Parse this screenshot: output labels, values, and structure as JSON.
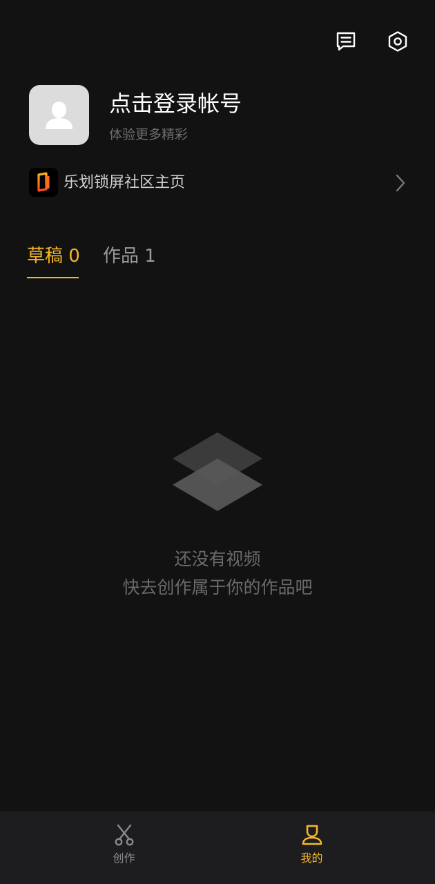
{
  "header": {
    "message_icon": "message-icon",
    "settings_icon": "settings-hexagon-icon"
  },
  "profile": {
    "avatar_icon": "user-silhouette-icon",
    "title": "点击登录帐号",
    "subtitle": "体验更多精彩"
  },
  "community": {
    "logo_icon": "community-logo-icon",
    "label": "乐划锁屏社区主页",
    "chevron_icon": "chevron-right-icon"
  },
  "tabs": [
    {
      "label": "草稿 0",
      "active": true
    },
    {
      "label": "作品 1",
      "active": false
    }
  ],
  "empty_state": {
    "icon": "stacked-layers-icon",
    "title": "还没有视频",
    "subtitle": "快去创作属于你的作品吧"
  },
  "bottom_nav": {
    "items": [
      {
        "label": "创作",
        "icon": "scissors-icon",
        "active": false
      },
      {
        "label": "我的",
        "icon": "profile-icon",
        "active": true
      }
    ]
  },
  "colors": {
    "background": "#121212",
    "accent": "#f5b728",
    "inactive_text": "#9a9a9a",
    "nav_background": "#1d1d1f"
  }
}
